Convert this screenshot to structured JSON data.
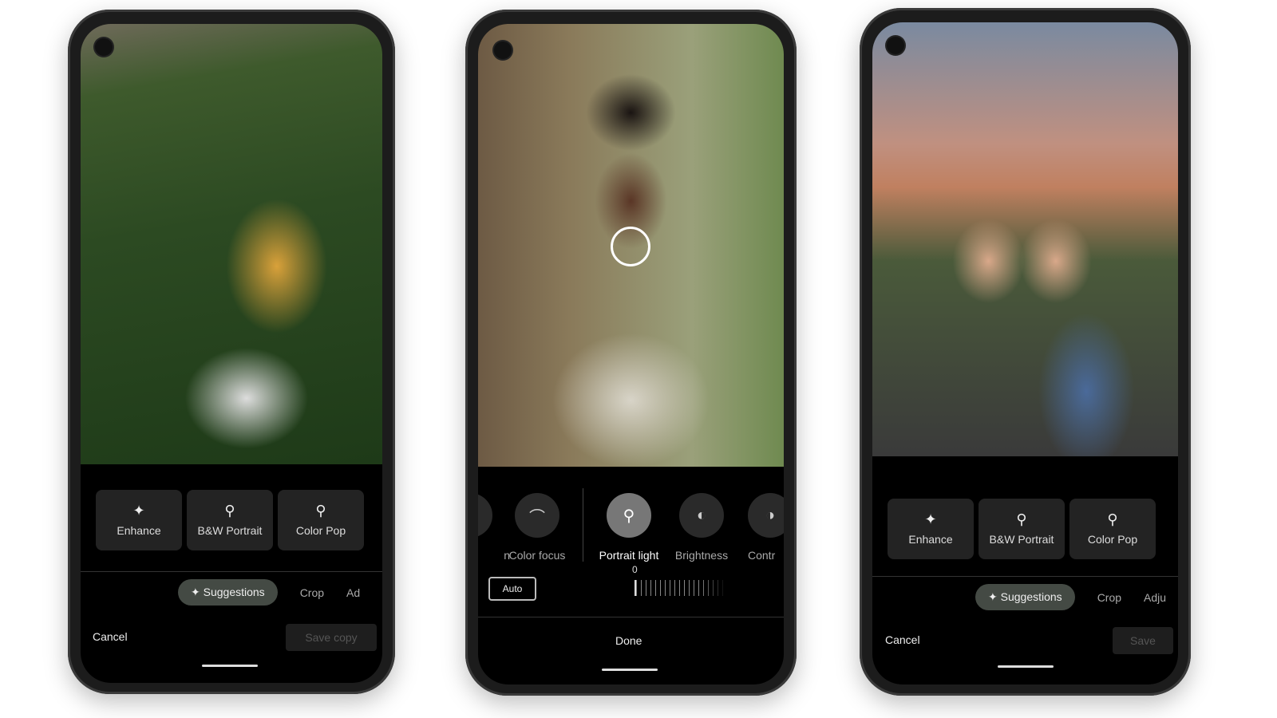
{
  "phone1": {
    "suggestions": [
      {
        "icon": "sparkle-icon",
        "label": "Enhance"
      },
      {
        "icon": "person-icon",
        "label": "B&W Portrait"
      },
      {
        "icon": "person-icon",
        "label": "Color Pop"
      }
    ],
    "tabs": {
      "suggestions": "Suggestions",
      "crop": "Crop",
      "adjust": "Ad"
    },
    "cancel": "Cancel",
    "save": "Save copy"
  },
  "phone2": {
    "tools": [
      {
        "icon": "partial-icon",
        "label": "n"
      },
      {
        "icon": "rainbow-icon",
        "label": "Color focus"
      },
      {
        "icon": "portrait-light-icon",
        "label": "Portrait light",
        "active": true
      },
      {
        "icon": "brightness-icon",
        "label": "Brightness"
      },
      {
        "icon": "contrast-icon",
        "label": "Contr"
      }
    ],
    "auto": "Auto",
    "slider_value": "0",
    "done": "Done"
  },
  "phone3": {
    "suggestions": [
      {
        "icon": "sparkle-icon",
        "label": "Enhance"
      },
      {
        "icon": "person-icon",
        "label": "B&W Portrait"
      },
      {
        "icon": "person-icon",
        "label": "Color Pop"
      }
    ],
    "tabs": {
      "suggestions": "Suggestions",
      "crop": "Crop",
      "adjust": "Adju"
    },
    "cancel": "Cancel",
    "save": "Save"
  },
  "colors": {
    "pill": "#444a44",
    "card": "#232323",
    "screen": "#000000"
  }
}
